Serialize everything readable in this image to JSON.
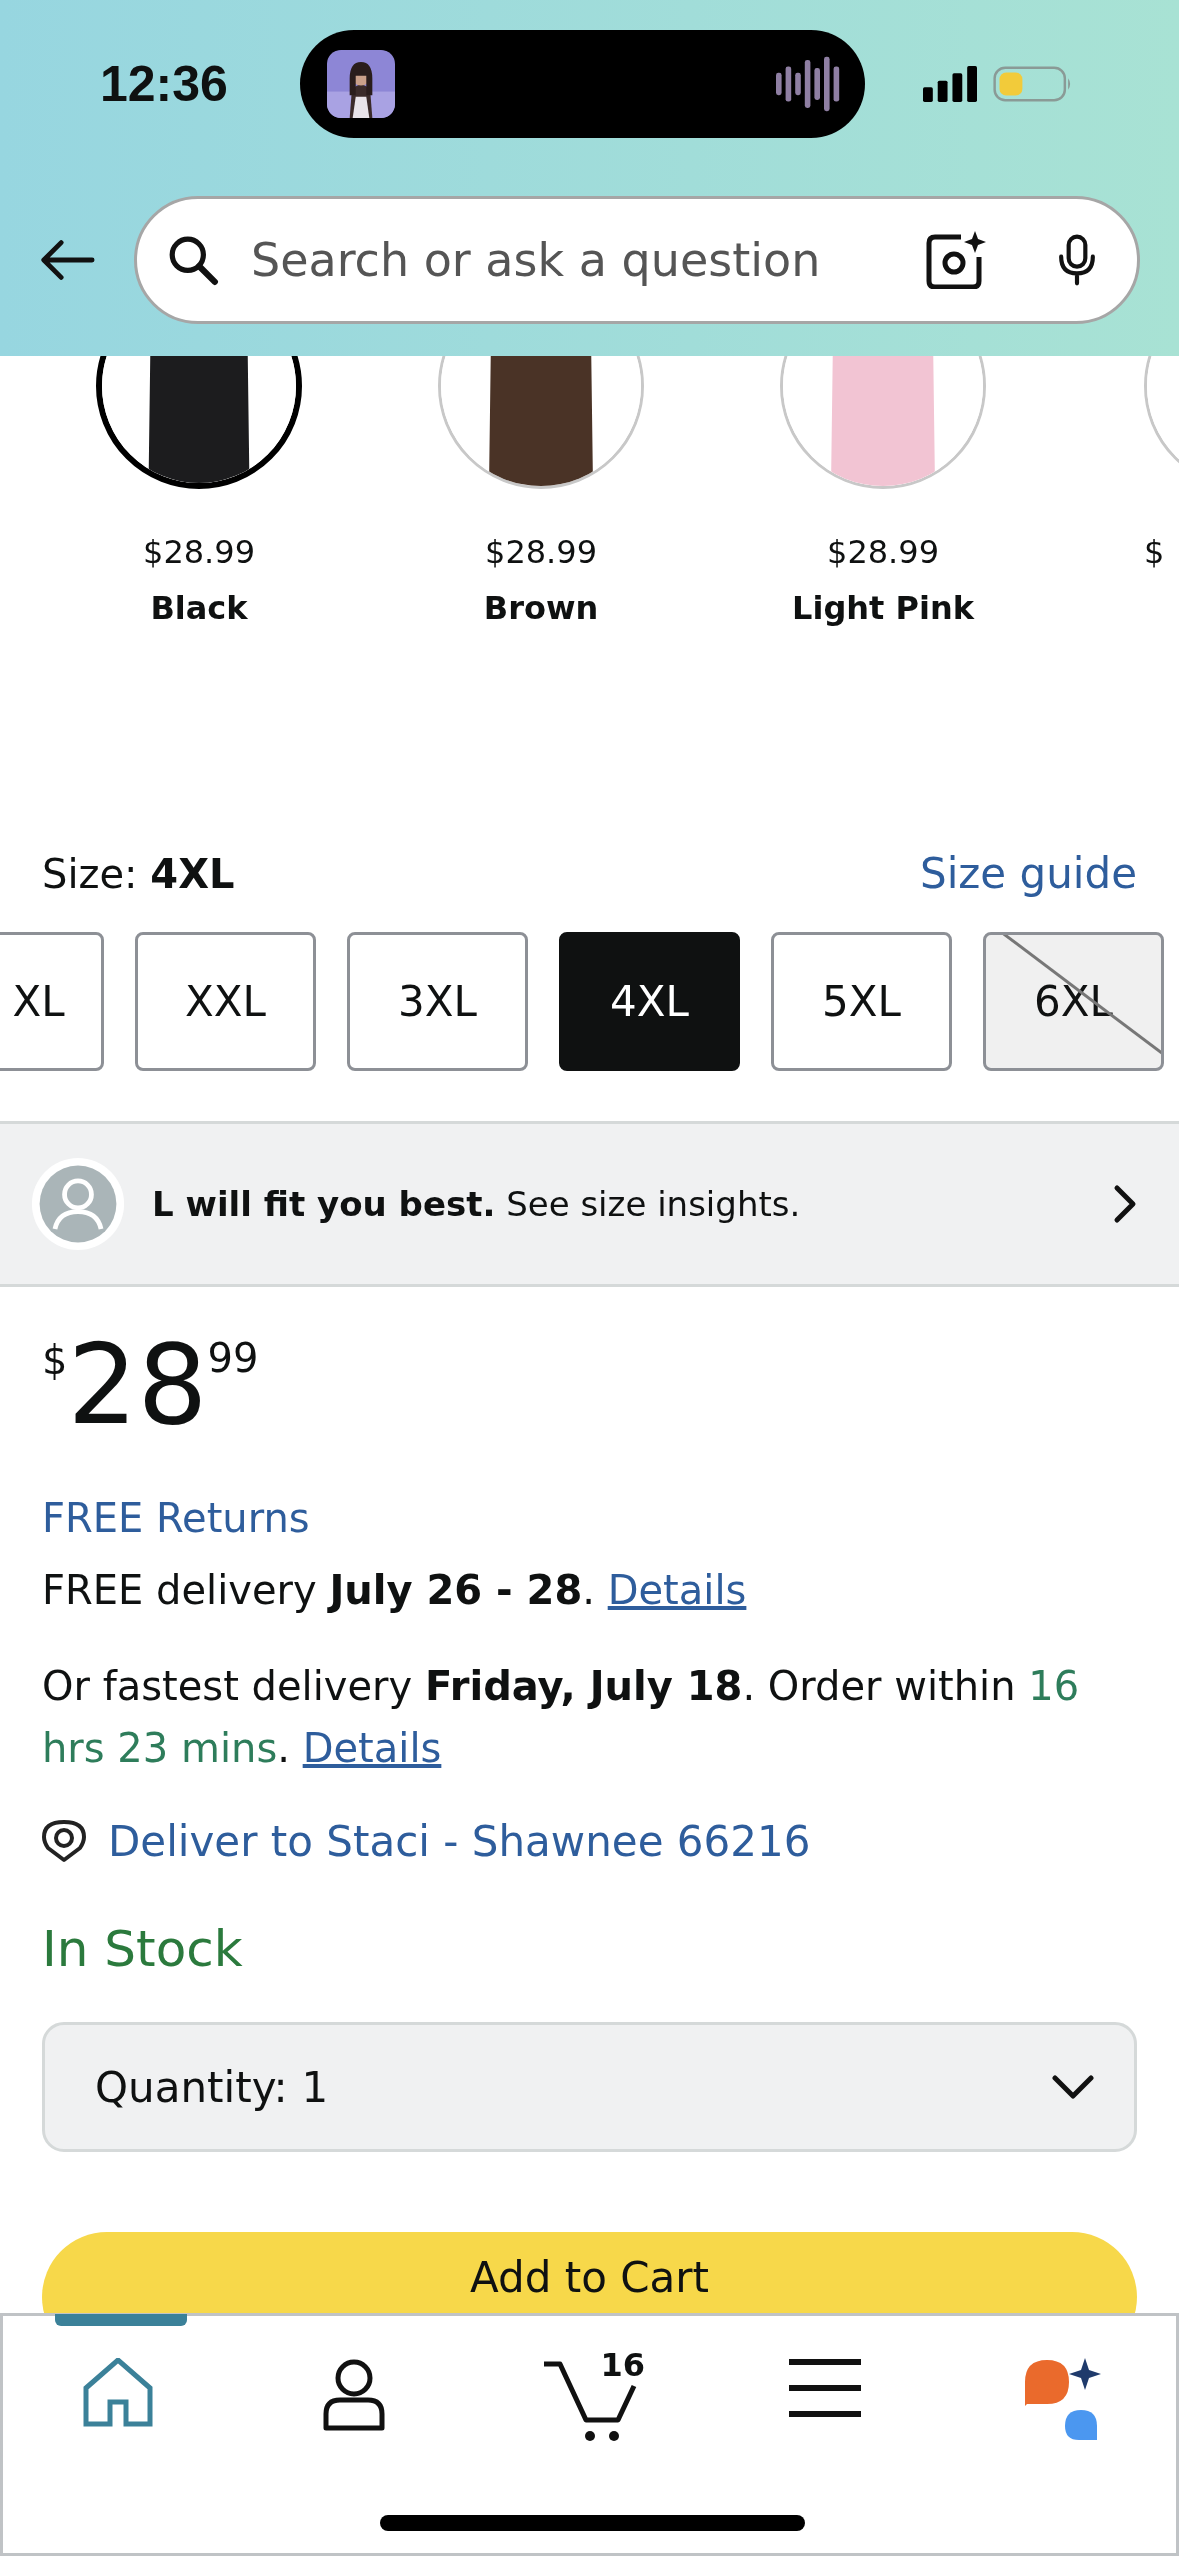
{
  "status_bar": {
    "time": "12:36"
  },
  "search": {
    "placeholder": "Search or ask a question"
  },
  "swatches": [
    {
      "price": "$28.99",
      "name": "Black",
      "selected": true
    },
    {
      "price": "$28.99",
      "name": "Brown",
      "selected": false
    },
    {
      "price": "$28.99",
      "name": "Light Pink",
      "selected": false
    },
    {
      "price": "$",
      "selected": false
    }
  ],
  "size": {
    "label": "Size: **4XL**",
    "guide": "Size guide"
  },
  "sizes": [
    {
      "label": "XL",
      "selected": false,
      "disabled": false
    },
    {
      "label": "XXL",
      "selected": false,
      "disabled": false
    },
    {
      "label": "3XL",
      "selected": false,
      "disabled": false
    },
    {
      "label": "4XL",
      "selected": true,
      "disabled": false
    },
    {
      "label": "5XL",
      "selected": false,
      "disabled": false
    },
    {
      "label": "6XL",
      "selected": false,
      "disabled": true
    }
  ],
  "fit_banner": {
    "text": "**L will fit you best.** See size insights."
  },
  "price": {
    "symbol": "$",
    "whole": "28",
    "fraction": "99"
  },
  "free_returns": "FREE Returns",
  "delivery_lines": [
    {
      "segments": [
        {
          "kind": "plain",
          "text": "FREE delivery "
        },
        {
          "kind": "bold",
          "text": "July 26 - 28"
        },
        {
          "kind": "plain",
          "text": ". "
        },
        {
          "kind": "link",
          "text": "Details"
        }
      ]
    },
    {
      "segments": [
        {
          "kind": "plain",
          "text": "Or fastest delivery "
        },
        {
          "kind": "bold",
          "text": "Friday, July 18"
        },
        {
          "kind": "plain",
          "text": ". Order within "
        },
        {
          "kind": "green",
          "text": "16 hrs 23 mins"
        },
        {
          "kind": "plain",
          "text": ". "
        },
        {
          "kind": "link",
          "text": "Details"
        }
      ]
    }
  ],
  "deliver_to": "Deliver to Staci - Shawnee 66216",
  "stock": "In Stock",
  "quantity": {
    "label": "Quantity:",
    "value": "1"
  },
  "add_to_cart": "Add to Cart",
  "nav": [
    {
      "kind": "home",
      "selected": true
    },
    {
      "kind": "profile",
      "selected": false
    },
    {
      "kind": "cart",
      "selected": false,
      "badge": "16"
    },
    {
      "kind": "menu",
      "selected": false
    },
    {
      "kind": "assistant",
      "selected": false
    }
  ]
}
